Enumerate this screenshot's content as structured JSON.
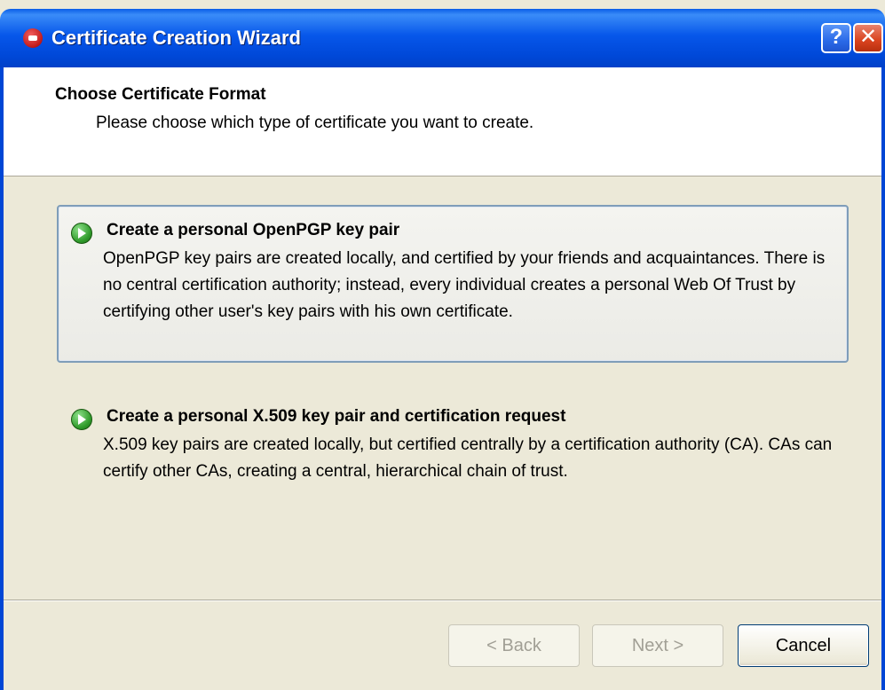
{
  "window": {
    "title": "Certificate Creation Wizard",
    "help_label": "?",
    "close_label": "✕"
  },
  "header": {
    "title": "Choose Certificate Format",
    "subtitle": "Please choose which type of certificate you want to create."
  },
  "options": [
    {
      "title": "Create a personal OpenPGP key pair",
      "description": "OpenPGP key pairs are created locally, and certified by your friends and acquaintances. There is no central certification authority; instead, every individual creates a personal Web Of Trust by certifying other user's key pairs with his own certificate.",
      "selected": true
    },
    {
      "title": "Create a personal X.509 key pair and certification request",
      "description": "X.509 key pairs are created locally, but certified centrally by a certification authority (CA). CAs can certify other CAs, creating a central, hierarchical chain of trust.",
      "selected": false
    }
  ],
  "buttons": {
    "back": "< Back",
    "next": "Next >",
    "cancel": "Cancel"
  },
  "colors": {
    "titlebar": "#0757ea",
    "window_bg": "#ece9d8",
    "selection_border": "#7f9db9"
  }
}
